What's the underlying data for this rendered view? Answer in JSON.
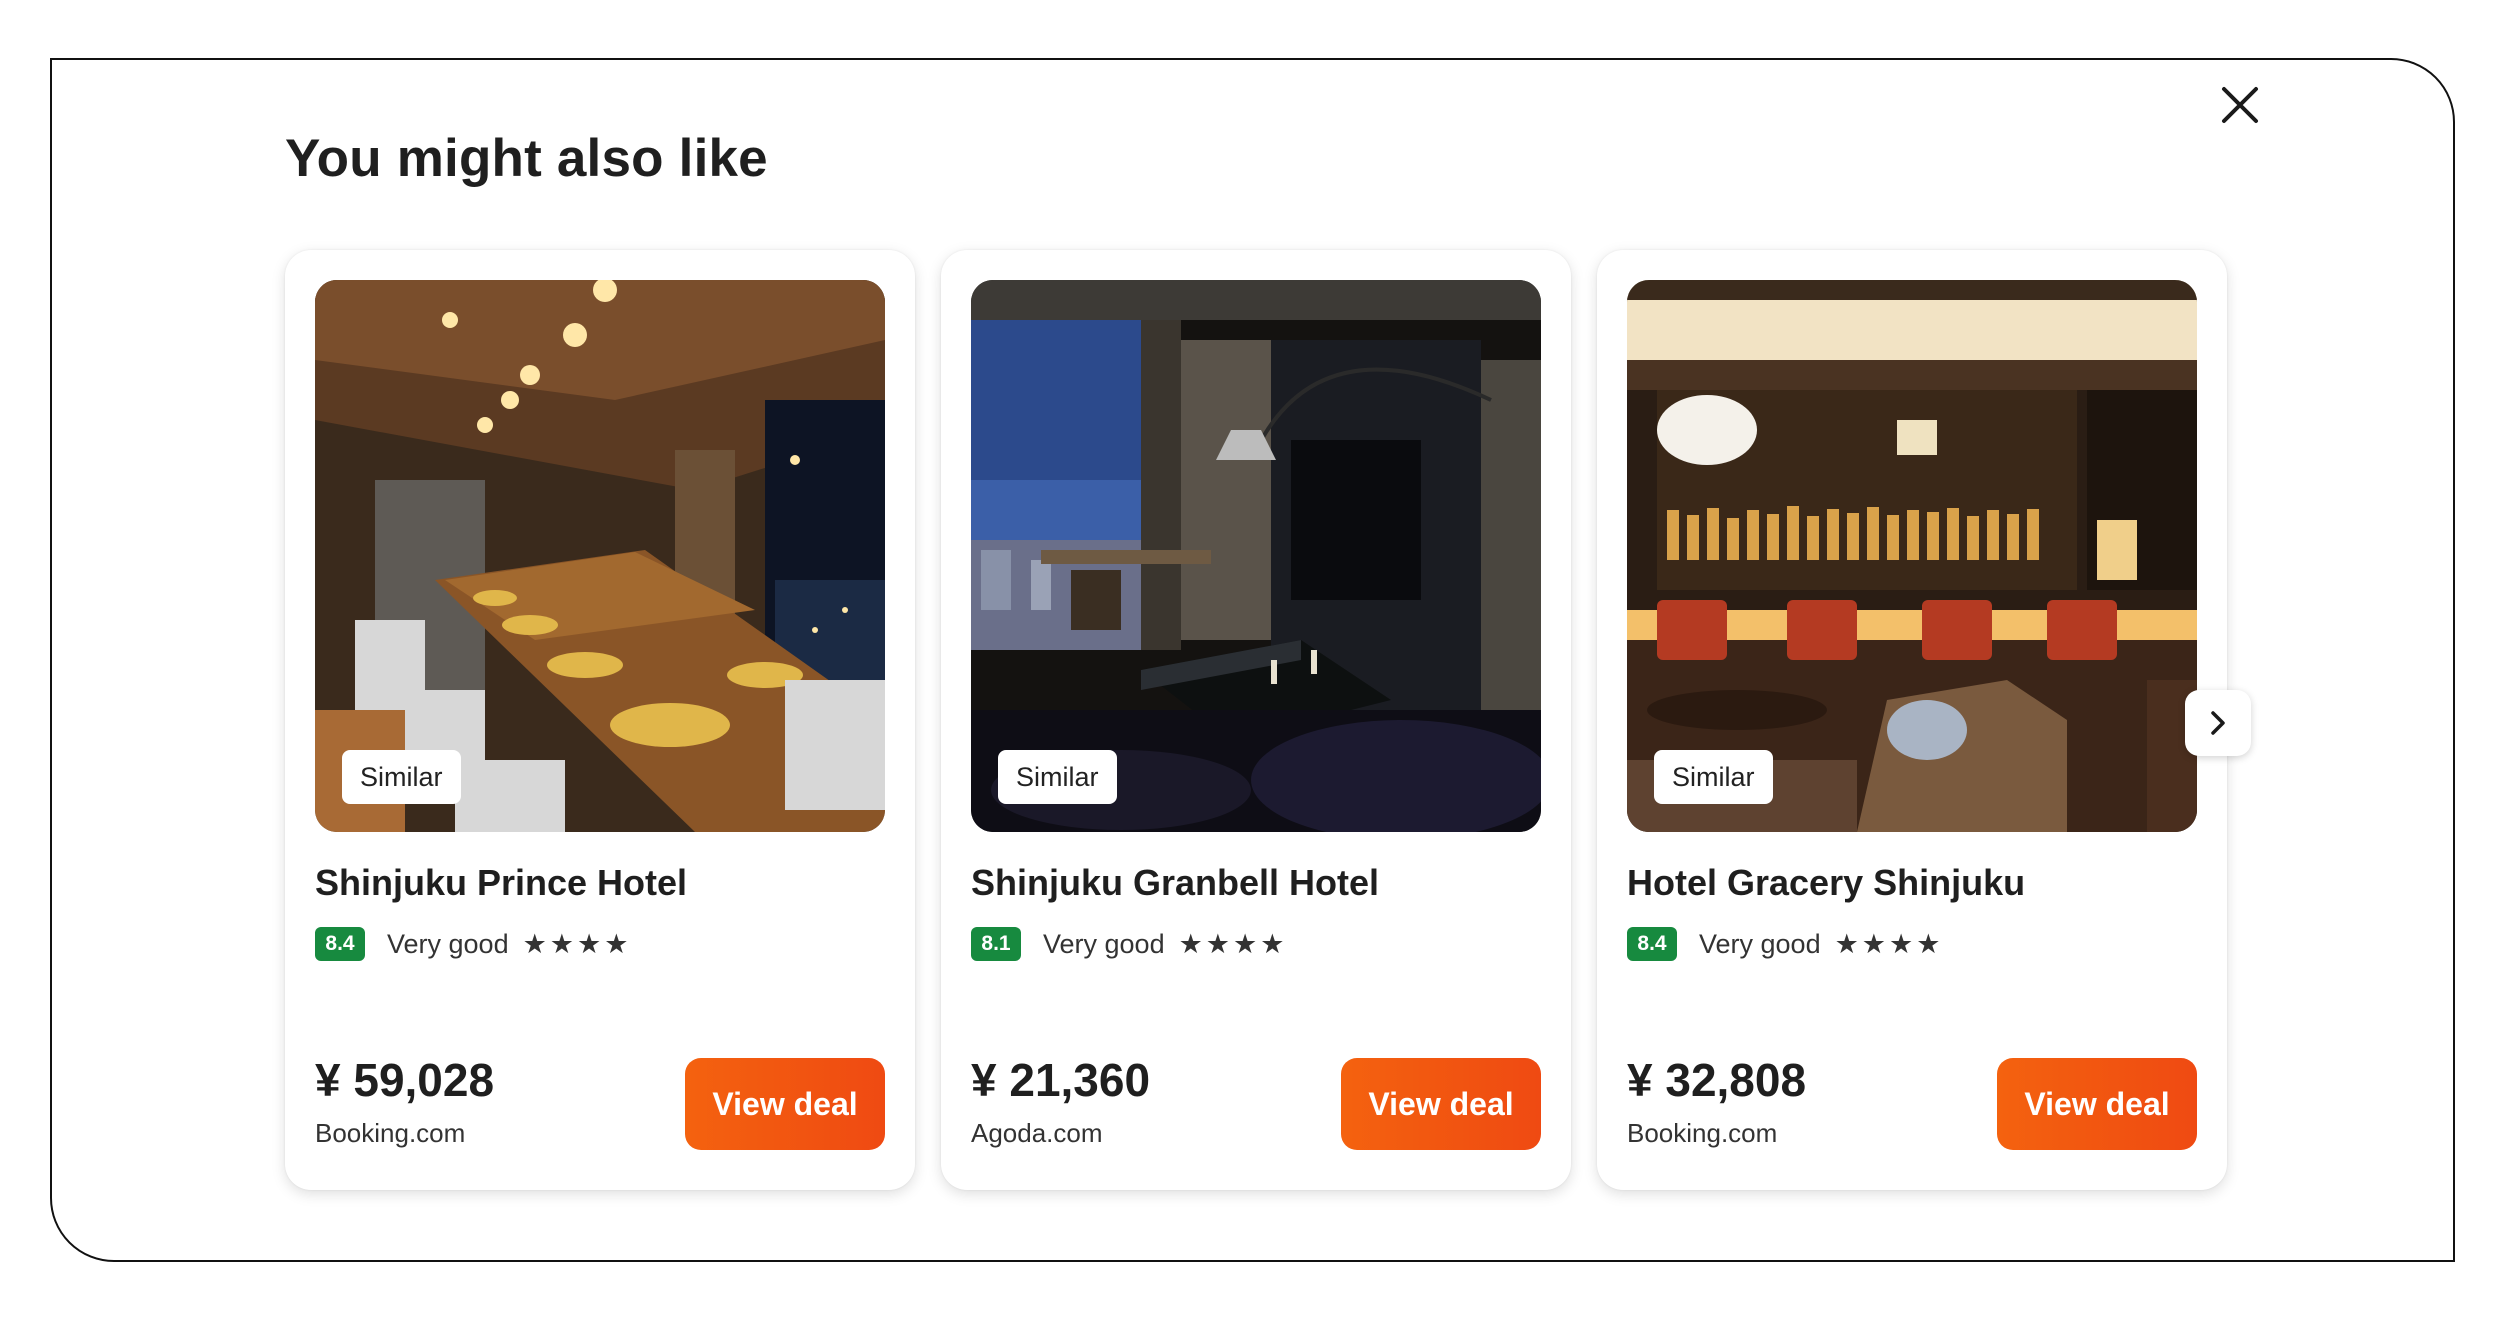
{
  "modal": {
    "title": "You might also like",
    "close_icon": "close-icon",
    "next_icon": "chevron-right-icon"
  },
  "cards": [
    {
      "badge": "Similar",
      "name": "Shinjuku Prince Hotel",
      "score": "8.4",
      "rating_label": "Very good",
      "stars": "★★★★",
      "price": "¥ 59,028",
      "provider": "Booking.com",
      "button": "View deal",
      "photo": "restaurant dining room with long table and city view"
    },
    {
      "badge": "Similar",
      "name": "Shinjuku Granbell Hotel",
      "score": "8.1",
      "rating_label": "Very good",
      "stars": "★★★★",
      "price": "¥ 21,360",
      "provider": "Agoda.com",
      "button": "View deal",
      "photo": "hotel room with night city view and glass table"
    },
    {
      "badge": "Similar",
      "name": "Hotel Gracery Shinjuku",
      "score": "8.4",
      "rating_label": "Very good",
      "stars": "★★★★",
      "price": "¥ 32,808",
      "provider": "Booking.com",
      "button": "View deal",
      "photo": "hotel bar with liquor shelves and red stools"
    }
  ],
  "colors": {
    "accent": "#f05a12",
    "score_bg": "#178a3f"
  }
}
